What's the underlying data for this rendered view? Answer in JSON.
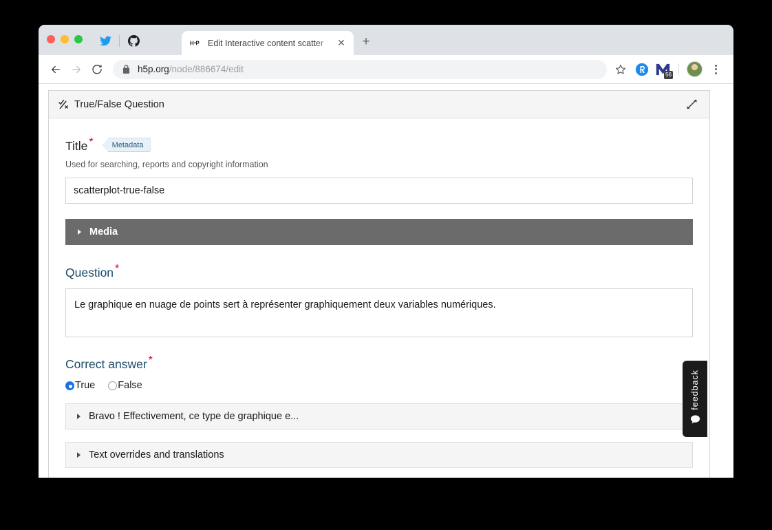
{
  "browser": {
    "tab": {
      "favicon": "h5p-logo-icon",
      "favicon_text": "H·P",
      "title": "Edit Interactive content scatter",
      "close_label": "✕"
    },
    "new_tab_label": "+",
    "nav": {
      "back_label": "←",
      "forward_label": "→",
      "reload_label": "↻"
    },
    "omnibox": {
      "lock": "lock-icon",
      "host": "h5p.org",
      "path": "/node/886674/edit",
      "full_url": "h5p.org/node/886674/edit"
    },
    "bookmarks": [
      {
        "name": "twitter-bookmark-icon"
      },
      {
        "name": "github-bookmark-icon"
      }
    ],
    "extensions": [
      {
        "name": "rakuten-extension-icon"
      },
      {
        "name": "momentum-extension-icon",
        "badge": "56"
      }
    ],
    "profile_avatar": "user-avatar",
    "menu_label": "⋮"
  },
  "editor": {
    "header": {
      "type_icon": "true-false-check-cross-icon",
      "title": "True/False Question",
      "fullscreen_icon": "expand-diagonal-icon"
    },
    "title_field": {
      "label": "Title",
      "required_marker": "*",
      "metadata_button": "Metadata",
      "description": "Used for searching, reports and copyright information",
      "value": "scatterplot-true-false",
      "placeholder": ""
    },
    "media_section": {
      "label": "Media",
      "expanded": false,
      "chevron": "chevron-right-icon"
    },
    "question_field": {
      "label": "Question",
      "required_marker": "*",
      "value": "Le graphique en nuage de points sert à représenter graphiquement deux variables numériques."
    },
    "correct_answer_field": {
      "label": "Correct answer",
      "required_marker": "*",
      "options": [
        {
          "label": "True",
          "checked": true
        },
        {
          "label": "False",
          "checked": false
        }
      ]
    },
    "accordions": [
      {
        "label": "Bravo ! Effectivement, ce type de graphique e...",
        "expanded": false,
        "chevron": "chevron-right-icon"
      },
      {
        "label": "Text overrides and translations",
        "expanded": false,
        "chevron": "chevron-right-icon"
      }
    ]
  },
  "feedback_tab": {
    "label": "feedback",
    "icon": "speech-bubble-icon"
  },
  "colors": {
    "accent_blue": "#1a73e8",
    "label_blue": "#1b4d6b",
    "required_red": "#d0021b",
    "media_bar_gray": "#6b6b6b",
    "feedback_black": "#1b1b1b"
  }
}
